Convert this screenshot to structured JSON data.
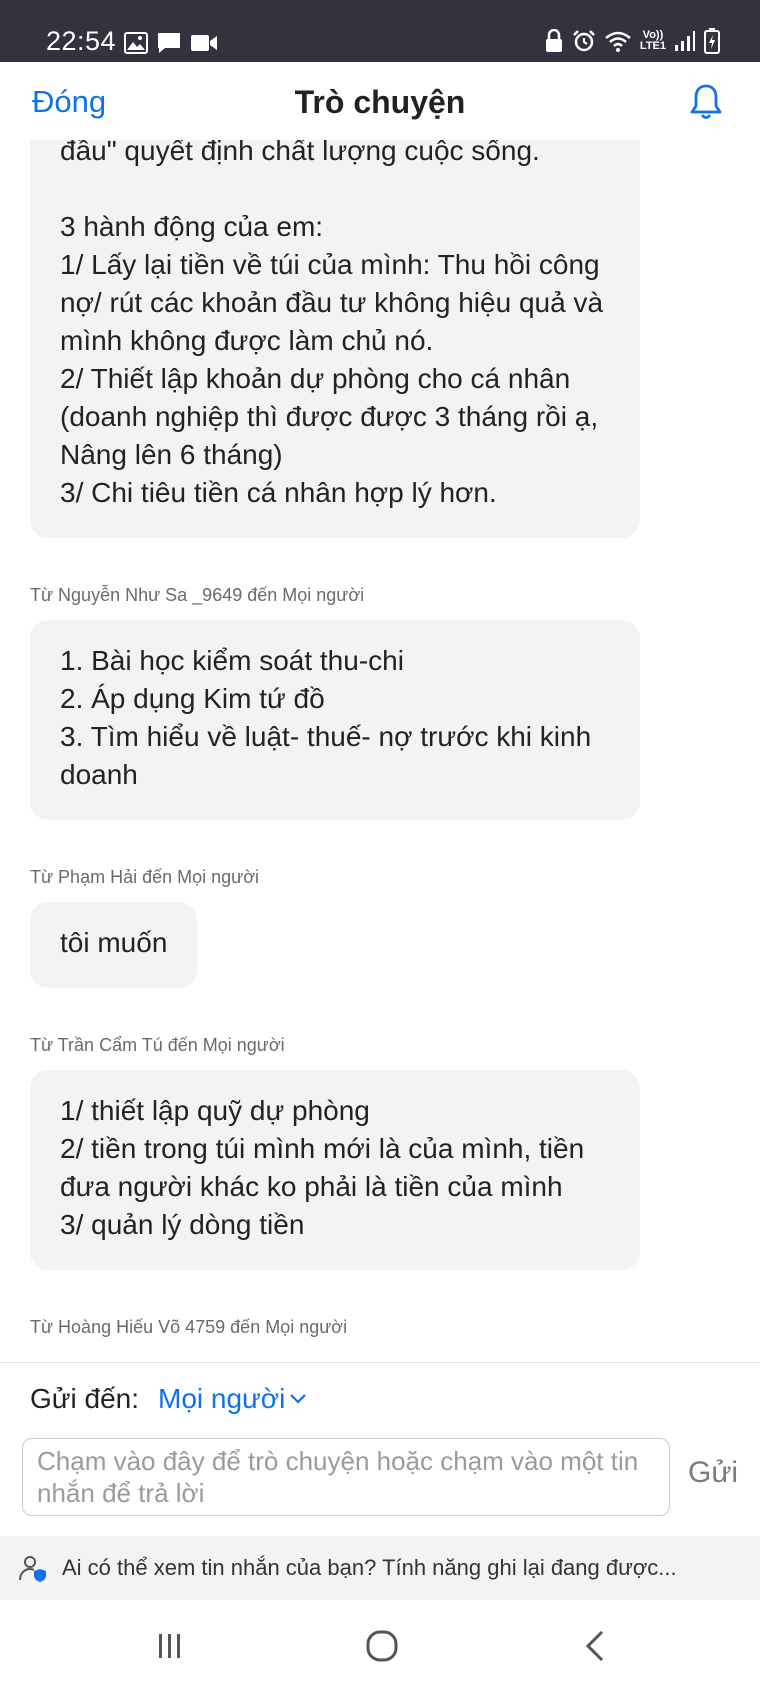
{
  "status_bar": {
    "time": "22:54",
    "network_label_top": "Vo))",
    "network_label_bottom": "LTE1",
    "icons": [
      "image-icon",
      "message-icon",
      "video-icon",
      "lock-icon",
      "alarm-icon",
      "wifi-icon",
      "signal-icon",
      "battery-icon"
    ]
  },
  "header": {
    "close_label": "Đóng",
    "title": "Trò chuyện"
  },
  "messages": [
    {
      "sender": "",
      "text": "đầu\" quyết định chất lượng cuộc sống.\n\n3 hành động của em:\n1/ Lấy lại tiền về túi của mình: Thu hồi công nợ/ rút các khoản đầu tư không hiệu quả và mình không được làm chủ nó.\n2/ Thiết lập khoản dự phòng cho cá nhân (doanh nghiệp thì được được 3 tháng rồi ạ, Nâng lên 6 tháng)\n3/ Chi tiêu tiền cá nhân hợp lý hơn."
    },
    {
      "sender": "Từ Nguyễn Như Sa _9649 đến Mọi người",
      "text": "1. Bài học kiểm soát thu-chi\n2. Áp dụng Kim tứ đồ\n3. Tìm hiểu về luật- thuế- nợ trước khi kinh doanh"
    },
    {
      "sender": "Từ Phạm Hải đến Mọi người",
      "text": "tôi muốn"
    },
    {
      "sender": "Từ Trần Cẩm Tú đến Mọi người",
      "text": "1/ thiết lập quỹ dự phòng\n2/ tiền trong túi mình mới là của mình, tiền đưa người khác ko phải là tiền của mình\n3/ quản lý dòng tiền"
    },
    {
      "sender": "Từ Hoàng Hiếu Võ 4759 đến Mọi người",
      "text": ""
    }
  ],
  "composer": {
    "send_to_label": "Gửi đến:",
    "send_to_value": "Mọi người",
    "input_placeholder": "Chạm vào đây để trò chuyện hoặc chạm vào một tin nhắn để trả lời",
    "send_label": "Gửi"
  },
  "notice": {
    "text": "Ai có thể xem tin nhắn của bạn? Tính năng ghi lại đang được..."
  },
  "colors": {
    "accent": "#0e72ed",
    "status_bar_bg": "#33333f",
    "bubble_bg": "#f3f3f6",
    "notice_bg": "#f3f3f6"
  }
}
